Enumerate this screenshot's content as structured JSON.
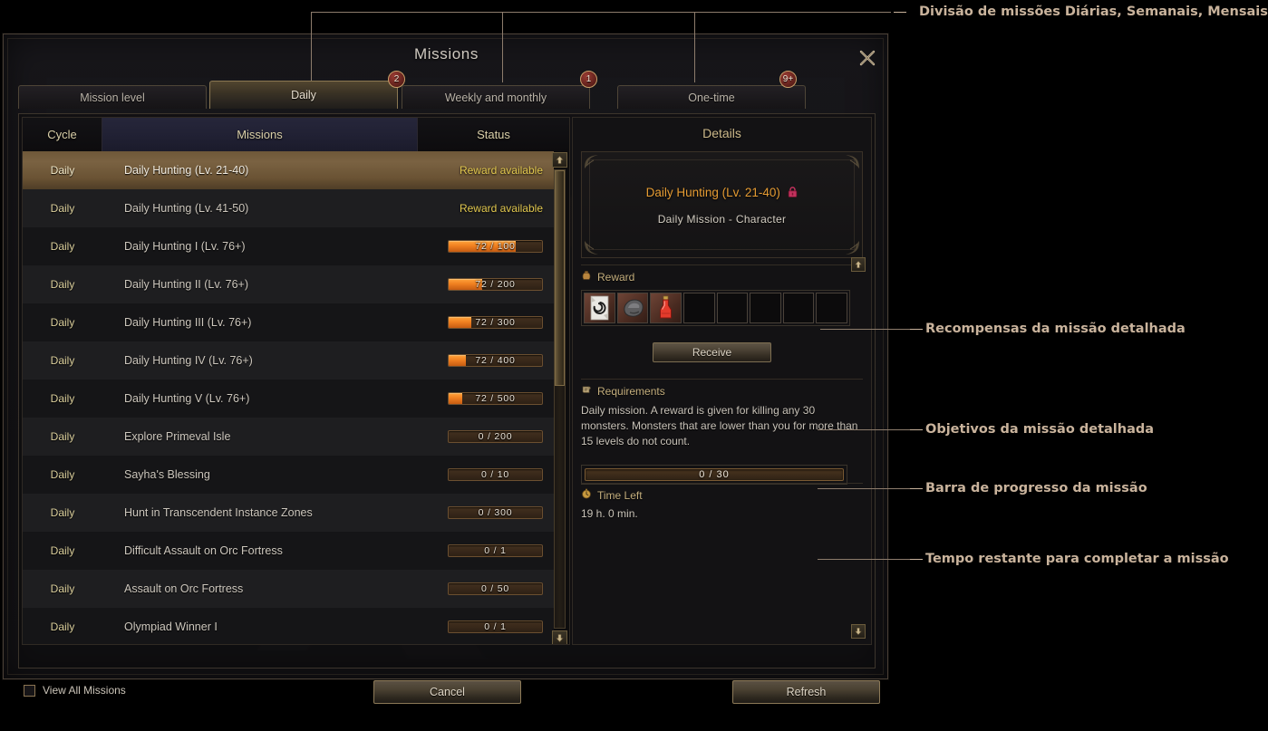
{
  "window": {
    "title": "Missions",
    "close_icon": "close-icon"
  },
  "tabs": [
    {
      "label": "Mission level",
      "badge": null,
      "active": false
    },
    {
      "label": "Daily",
      "badge": "2",
      "active": true
    },
    {
      "label": "Weekly and monthly",
      "badge": "1",
      "active": false
    },
    {
      "label": "One-time",
      "badge": "9+",
      "active": false
    }
  ],
  "table": {
    "columns": [
      "Cycle",
      "Missions",
      "Status"
    ],
    "rows": [
      {
        "cycle": "Daily",
        "name": "Daily Hunting (Lv. 21-40)",
        "status_type": "text",
        "status": "Reward available",
        "selected": true
      },
      {
        "cycle": "Daily",
        "name": "Daily Hunting (Lv. 41-50)",
        "status_type": "text",
        "status": "Reward available",
        "selected": false
      },
      {
        "cycle": "Daily",
        "name": "Daily Hunting I (Lv. 76+)",
        "status_type": "progress",
        "current": 72,
        "max": 100,
        "status": "72 / 100",
        "selected": false
      },
      {
        "cycle": "Daily",
        "name": "Daily Hunting II (Lv. 76+)",
        "status_type": "progress",
        "current": 72,
        "max": 200,
        "status": "72 / 200",
        "selected": false
      },
      {
        "cycle": "Daily",
        "name": "Daily Hunting III (Lv. 76+)",
        "status_type": "progress",
        "current": 72,
        "max": 300,
        "status": "72 / 300",
        "selected": false
      },
      {
        "cycle": "Daily",
        "name": "Daily Hunting IV (Lv. 76+)",
        "status_type": "progress",
        "current": 72,
        "max": 400,
        "status": "72 / 400",
        "selected": false
      },
      {
        "cycle": "Daily",
        "name": "Daily Hunting V (Lv. 76+)",
        "status_type": "progress",
        "current": 72,
        "max": 500,
        "status": "72 / 500",
        "selected": false
      },
      {
        "cycle": "Daily",
        "name": "Explore Primeval Isle",
        "status_type": "progress",
        "current": 0,
        "max": 200,
        "status": "0 / 200",
        "selected": false
      },
      {
        "cycle": "Daily",
        "name": "Sayha's Blessing",
        "status_type": "progress",
        "current": 0,
        "max": 10,
        "status": "0 / 10",
        "selected": false
      },
      {
        "cycle": "Daily",
        "name": "Hunt in Transcendent Instance Zones",
        "status_type": "progress",
        "current": 0,
        "max": 300,
        "status": "0 / 300",
        "selected": false
      },
      {
        "cycle": "Daily",
        "name": "Difficult Assault on Orc Fortress",
        "status_type": "progress",
        "current": 0,
        "max": 1,
        "status": "0 / 1",
        "selected": false
      },
      {
        "cycle": "Daily",
        "name": "Assault on Orc Fortress",
        "status_type": "progress",
        "current": 0,
        "max": 50,
        "status": "0 / 50",
        "selected": false
      },
      {
        "cycle": "Daily",
        "name": "Olympiad Winner I",
        "status_type": "progress",
        "current": 0,
        "max": 1,
        "status": "0 / 1",
        "selected": false
      }
    ]
  },
  "details": {
    "title": "Details",
    "quest_name": "Daily Hunting (Lv. 21-40)",
    "lock_icon": "lock-icon",
    "quest_subtitle": "Daily Mission  -  Character",
    "reward": {
      "heading": "Reward",
      "heading_icon": "coin-pouch-icon",
      "slot_count": 8,
      "items": [
        "scroll-item-icon",
        "ore-item-icon",
        "red-potion-item-icon"
      ],
      "receive_label": "Receive"
    },
    "requirements": {
      "heading": "Requirements",
      "heading_icon": "scroll-icon",
      "text": "Daily mission. A reward is given for killing any 30 monsters. Monsters that are lower than you for more than 15 levels do not count.",
      "progress_current": 0,
      "progress_max": 30,
      "progress_label": "0 / 30"
    },
    "time_left": {
      "heading": "Time Left",
      "heading_icon": "hourglass-icon",
      "value": "19 h. 0 min."
    }
  },
  "footer": {
    "view_all_label": "View All Missions",
    "view_all_checked": false,
    "cancel_label": "Cancel",
    "refresh_label": "Refresh"
  },
  "annotations": [
    {
      "text": "Divisão de missões Diárias, Semanais, Mensais e Únicas"
    },
    {
      "text": "Recompensas da missão detalhada"
    },
    {
      "text": "Objetivos da missão detalhada"
    },
    {
      "text": "Barra de progresso da missão"
    },
    {
      "text": "Tempo restante para completar a missão"
    }
  ],
  "colors": {
    "accent_gold": "#c9a961",
    "quest_orange": "#e59b33",
    "status_yellow": "#e2c84f",
    "progress_fill": "#f08020",
    "selection": "#7a6242",
    "annotation": "#c9b39c"
  }
}
